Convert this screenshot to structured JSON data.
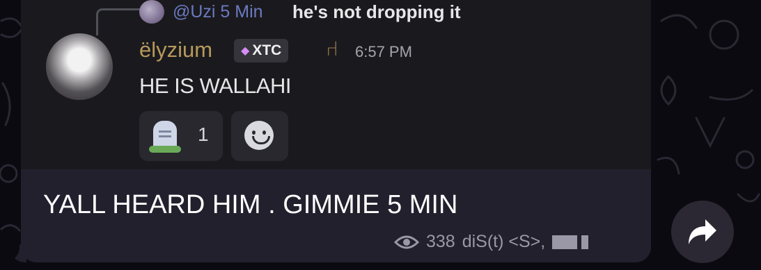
{
  "reply": {
    "username": "@Uzi 5 Min",
    "text": "he's not dropping it"
  },
  "author": {
    "name": "ëlyzium",
    "badge_tag": "XTC",
    "badge_icon": "gem-icon",
    "extra_icon": "chair-icon",
    "time": "6:57 PM"
  },
  "message": {
    "text": "HE IS WALLAHI"
  },
  "reactions": [
    {
      "icon": "tombstone-icon",
      "count": "1"
    }
  ],
  "caption": "YALL HEARD HIM . GIMMIE 5 MIN",
  "meta": {
    "views": "338",
    "author_signature": "diS(t) <S>,"
  },
  "colors": {
    "bubble": "#23202e",
    "discord_bg": "#1a1a1e",
    "username": "#b7995a",
    "reply_user": "#6b7ac0",
    "meta_text": "#9a97a6"
  }
}
